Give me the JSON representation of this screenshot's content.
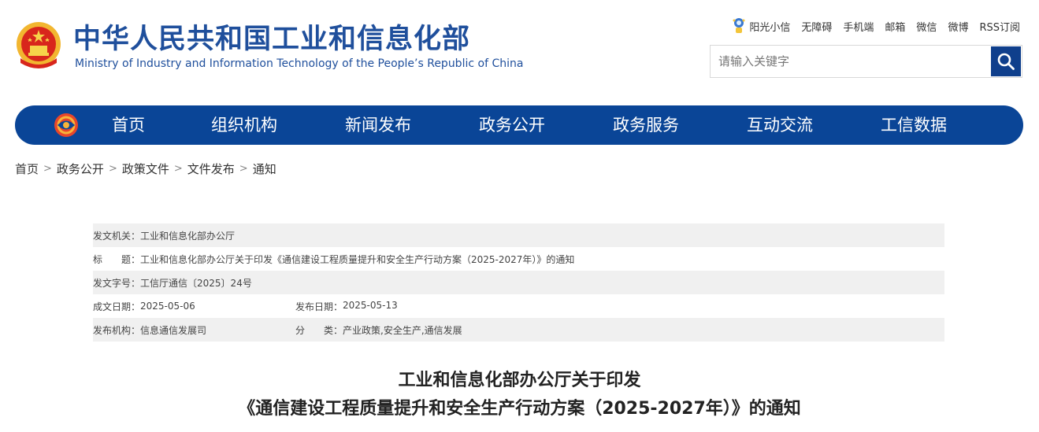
{
  "header": {
    "title": "中华人民共和国工业和信息化部",
    "subtitle": "Ministry of Industry and Information Technology of the People’s Republic of China",
    "toplinks": [
      "阳光小信",
      "无障碍",
      "手机端",
      "邮箱",
      "微信",
      "微博",
      "RSS订阅"
    ],
    "search_placeholder": "请输入关键字",
    "search_icon": "search-icon"
  },
  "nav": {
    "items": [
      "首页",
      "组织机构",
      "新闻发布",
      "政务公开",
      "政务服务",
      "互动交流",
      "工信数据"
    ]
  },
  "breadcrumb": [
    "首页",
    "政务公开",
    "政策文件",
    "文件发布",
    "通知"
  ],
  "info": {
    "issuer_label": "发文机关：",
    "issuer": "工业和信息化部办公厅",
    "title_label": "标　　题：",
    "title": "工业和信息化部办公厅关于印发《通信建设工程质量提升和安全生产行动方案（2025-2027年）》的通知",
    "docno_label": "发文字号：",
    "docno": "工信厅通信〔2025〕24号",
    "written_label": "成文日期：",
    "written": "2025-05-06",
    "published_label": "发布日期：",
    "published": "2025-05-13",
    "agency_label": "发布机构：",
    "agency": "信息通信发展司",
    "category_label": "分　　类：",
    "category": "产业政策,安全生产,通信发展"
  },
  "document": {
    "title_line1": "工业和信息化部办公厅关于印发",
    "title_line2": "《通信建设工程质量提升和安全生产行动方案（2025-2027年）》的通知"
  },
  "colors": {
    "brand_blue": "#0a4597",
    "title_blue": "#1f4f9c",
    "shade": "#f0f0f0"
  }
}
